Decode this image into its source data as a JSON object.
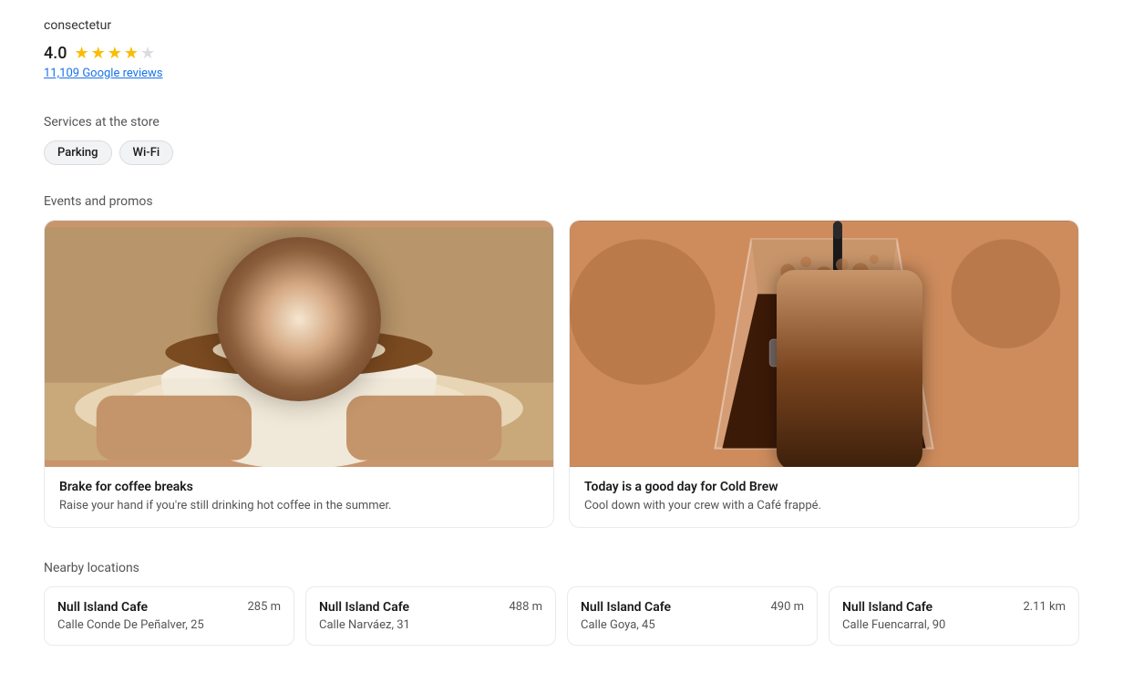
{
  "description": "consectetur",
  "rating": {
    "score": "4.0",
    "reviews_text": "11,109 Google reviews",
    "stars": [
      "filled",
      "filled",
      "filled",
      "filled",
      "empty"
    ]
  },
  "services": {
    "label": "Services at the store",
    "tags": [
      "Parking",
      "Wi-Fi"
    ]
  },
  "events": {
    "label": "Events and promos",
    "cards": [
      {
        "title": "Brake for coffee breaks",
        "description": "Raise your hand if you're still drinking hot coffee in the summer.",
        "type": "latte"
      },
      {
        "title": "Today is a good day for Cold Brew",
        "description": "Cool down with your crew with a Café frappé.",
        "type": "coldbrew"
      }
    ]
  },
  "nearby": {
    "label": "Nearby locations",
    "locations": [
      {
        "name": "Null Island Cafe",
        "distance": "285 m",
        "address": "Calle Conde De Peñalver, 25"
      },
      {
        "name": "Null Island Cafe",
        "distance": "488 m",
        "address": "Calle Narváez, 31"
      },
      {
        "name": "Null Island Cafe",
        "distance": "490 m",
        "address": "Calle Goya, 45"
      },
      {
        "name": "Null Island Cafe",
        "distance": "2.11 km",
        "address": "Calle Fuencarral, 90"
      }
    ]
  }
}
